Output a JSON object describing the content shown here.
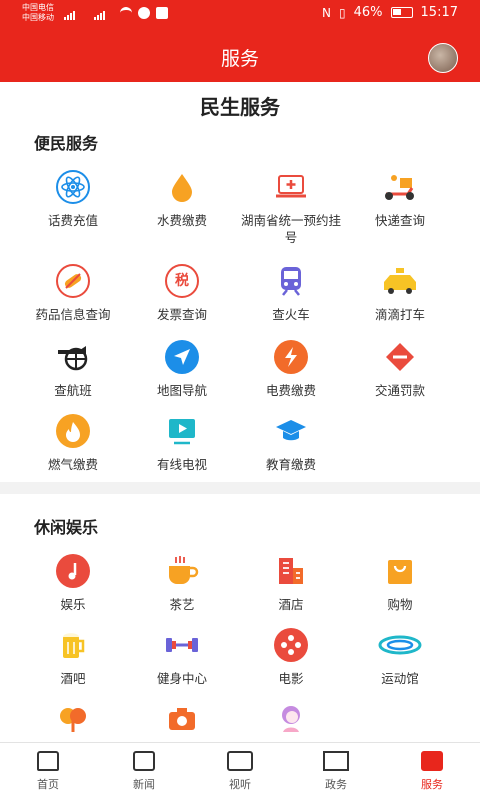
{
  "status_bar": {
    "carrier1": "中国电信",
    "carrier2": "中国移动",
    "battery": "46%",
    "time": "15:17"
  },
  "header": {
    "title": "服务"
  },
  "page_heading": "民生服务",
  "sections": [
    {
      "title": "便民服务",
      "items": [
        {
          "label": "话费充值",
          "icon": "atom-icon"
        },
        {
          "label": "水费缴费",
          "icon": "water-drop-icon"
        },
        {
          "label": "湖南省统一预约挂号",
          "icon": "medical-laptop-icon"
        },
        {
          "label": "快递查询",
          "icon": "delivery-scooter-icon"
        },
        {
          "label": "药品信息查询",
          "icon": "pill-icon"
        },
        {
          "label": "发票查询",
          "icon": "invoice-seal-icon"
        },
        {
          "label": "查火车",
          "icon": "train-icon"
        },
        {
          "label": "滴滴打车",
          "icon": "taxi-icon"
        },
        {
          "label": "查航班",
          "icon": "airplane-icon"
        },
        {
          "label": "地图导航",
          "icon": "navigation-arrow-icon"
        },
        {
          "label": "电费缴费",
          "icon": "lightning-icon"
        },
        {
          "label": "交通罚款",
          "icon": "no-entry-icon"
        },
        {
          "label": "燃气缴费",
          "icon": "flame-icon"
        },
        {
          "label": "有线电视",
          "icon": "tv-play-icon"
        },
        {
          "label": "教育缴费",
          "icon": "graduation-cap-icon"
        }
      ]
    },
    {
      "title": "休闲娱乐",
      "items": [
        {
          "label": "娱乐",
          "icon": "music-note-icon"
        },
        {
          "label": "茶艺",
          "icon": "tea-cup-icon"
        },
        {
          "label": "酒店",
          "icon": "hotel-building-icon"
        },
        {
          "label": "购物",
          "icon": "shopping-bag-icon"
        },
        {
          "label": "酒吧",
          "icon": "beer-mug-icon"
        },
        {
          "label": "健身中心",
          "icon": "dumbbell-icon"
        },
        {
          "label": "电影",
          "icon": "film-reel-icon"
        },
        {
          "label": "运动馆",
          "icon": "stadium-icon"
        },
        {
          "label": "",
          "icon": "tree-icon"
        },
        {
          "label": "",
          "icon": "camera-icon"
        },
        {
          "label": "",
          "icon": "beauty-woman-icon"
        }
      ]
    }
  ],
  "bottom_nav": [
    {
      "label": "首页",
      "icon": "home-icon"
    },
    {
      "label": "新闻",
      "icon": "news-icon"
    },
    {
      "label": "视听",
      "icon": "video-camera-icon"
    },
    {
      "label": "政务",
      "icon": "government-building-icon"
    },
    {
      "label": "服务",
      "icon": "service-icon",
      "active": true
    }
  ],
  "colors": {
    "brand": "#e8261c",
    "blue": "#1c8ee8",
    "orange": "#f7a223"
  }
}
